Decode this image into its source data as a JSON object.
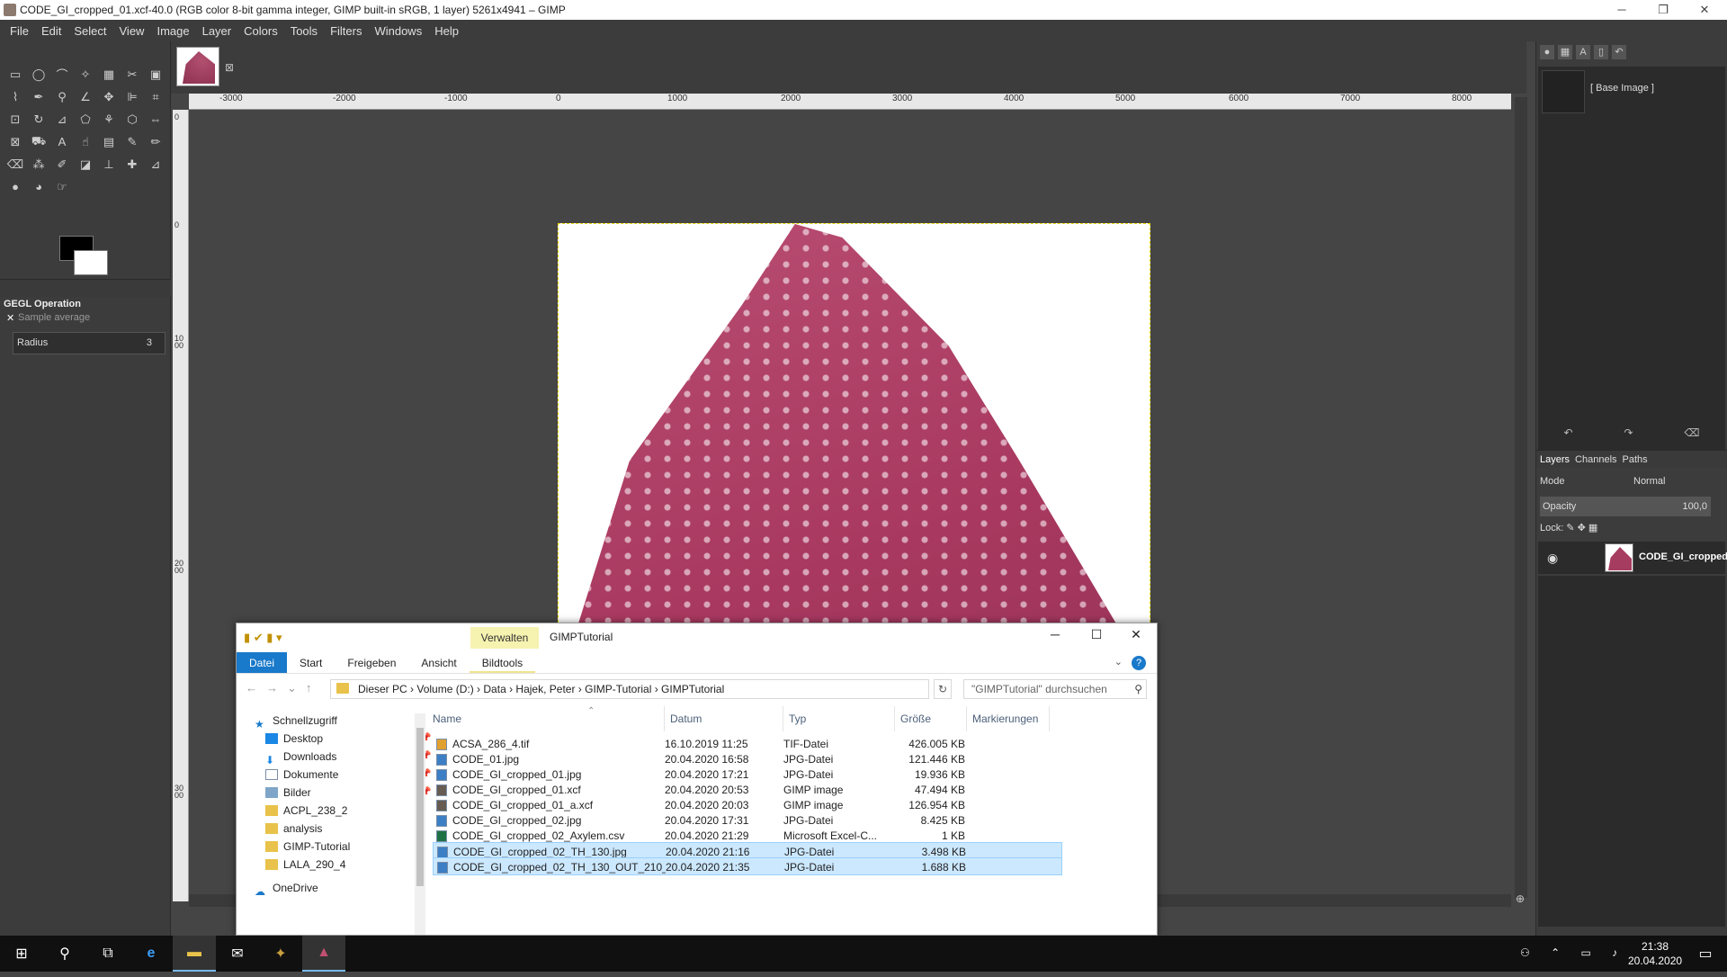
{
  "gimp": {
    "title": "CODE_GI_cropped_01.xcf-40.0 (RGB color 8-bit gamma integer, GIMP built-in sRGB, 1 layer) 5261x4941 – GIMP",
    "menu": [
      "File",
      "Edit",
      "Select",
      "View",
      "Image",
      "Layer",
      "Colors",
      "Tools",
      "Filters",
      "Windows",
      "Help"
    ],
    "tool_options": {
      "operation_title": "GEGL Operation",
      "operation_name": "Sample average",
      "radius_label": "Radius",
      "radius_value": "3"
    },
    "ruler_labels": [
      "-3000",
      "-2000",
      "-1000",
      "0",
      "1000",
      "2000",
      "3000",
      "4000",
      "5000",
      "6000",
      "7000",
      "8000"
    ],
    "vruler_labels": [
      "0",
      "0",
      "1000",
      "2000",
      "3000"
    ],
    "channels": {
      "base_label": "[ Base Image ]"
    },
    "layers": {
      "tabs": [
        "Layers",
        "Channels",
        "Paths"
      ],
      "mode_label": "Mode",
      "mode_value": "Normal",
      "opacity_label": "Opacity",
      "opacity_value": "100,0",
      "lock_label": "Lock:",
      "layer_name": "CODE_GI_cropped"
    }
  },
  "explorer": {
    "verwalten": "Verwalten",
    "title": "GIMPTutorial",
    "ribbon": [
      "Datei",
      "Start",
      "Freigeben",
      "Ansicht",
      "Bildtools"
    ],
    "path": [
      "Dieser PC",
      "Volume (D:)",
      "Data",
      "Hajek, Peter",
      "GIMP-Tutorial",
      "GIMPTutorial"
    ],
    "search_placeholder": "\"GIMPTutorial\" durchsuchen",
    "nav": [
      {
        "label": "Schnellzugriff",
        "icon": "star-icon"
      },
      {
        "label": "Desktop",
        "icon": "desktop-icon",
        "pinned": true
      },
      {
        "label": "Downloads",
        "icon": "download-icon",
        "pinned": true
      },
      {
        "label": "Dokumente",
        "icon": "documents-icon",
        "pinned": true
      },
      {
        "label": "Bilder",
        "icon": "pictures-icon",
        "pinned": true
      },
      {
        "label": "ACPL_238_2",
        "icon": "folder-icon"
      },
      {
        "label": "analysis",
        "icon": "folder-icon"
      },
      {
        "label": "GIMP-Tutorial",
        "icon": "folder-icon"
      },
      {
        "label": "LALA_290_4",
        "icon": "folder-icon"
      },
      {
        "label": "OneDrive",
        "icon": "cloud-icon"
      }
    ],
    "columns": [
      "Name",
      "Datum",
      "Typ",
      "Größe",
      "Markierungen"
    ],
    "files": [
      {
        "name": "ACSA_286_4.tif",
        "date": "16.10.2019 11:25",
        "type": "TIF-Datei",
        "size": "426.005 KB",
        "icon": "tif",
        "selected": false
      },
      {
        "name": "CODE_01.jpg",
        "date": "20.04.2020 16:58",
        "type": "JPG-Datei",
        "size": "121.446 KB",
        "icon": "jpg",
        "selected": false
      },
      {
        "name": "CODE_GI_cropped_01.jpg",
        "date": "20.04.2020 17:21",
        "type": "JPG-Datei",
        "size": "19.936 KB",
        "icon": "jpg",
        "selected": false
      },
      {
        "name": "CODE_GI_cropped_01.xcf",
        "date": "20.04.2020 20:53",
        "type": "GIMP image",
        "size": "47.494 KB",
        "icon": "xcf",
        "selected": false
      },
      {
        "name": "CODE_GI_cropped_01_a.xcf",
        "date": "20.04.2020 20:03",
        "type": "GIMP image",
        "size": "126.954 KB",
        "icon": "xcf",
        "selected": false
      },
      {
        "name": "CODE_GI_cropped_02.jpg",
        "date": "20.04.2020 17:31",
        "type": "JPG-Datei",
        "size": "8.425 KB",
        "icon": "jpg",
        "selected": false
      },
      {
        "name": "CODE_GI_cropped_02_Axylem.csv",
        "date": "20.04.2020 21:29",
        "type": "Microsoft Excel-C...",
        "size": "1 KB",
        "icon": "csv",
        "selected": false
      },
      {
        "name": "CODE_GI_cropped_02_TH_130.jpg",
        "date": "20.04.2020 21:16",
        "type": "JPG-Datei",
        "size": "3.498 KB",
        "icon": "jpg",
        "selected": true
      },
      {
        "name": "CODE_GI_cropped_02_TH_130_OUT_210_...",
        "date": "20.04.2020 21:35",
        "type": "JPG-Datei",
        "size": "1.688 KB",
        "icon": "jpg",
        "selected": true
      }
    ]
  },
  "taskbar": {
    "time": "21:38",
    "date": "20.04.2020"
  }
}
